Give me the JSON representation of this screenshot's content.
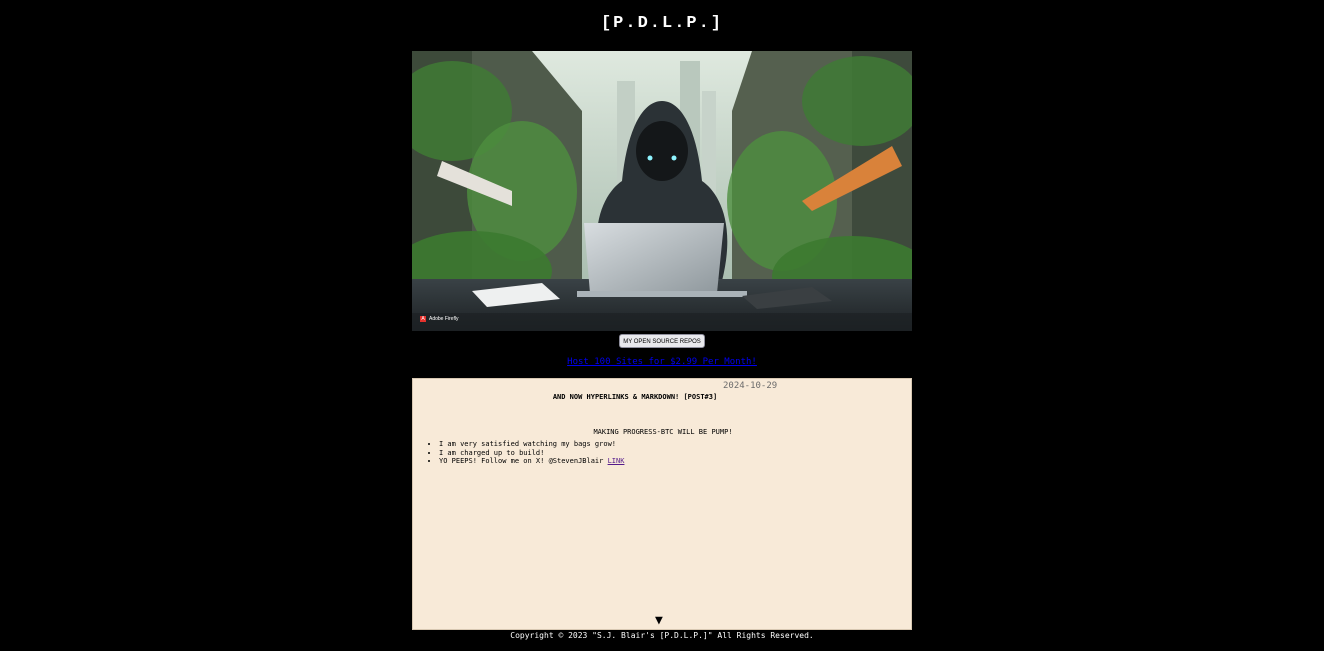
{
  "header": {
    "title": "[P.D.L.P.]"
  },
  "hero": {
    "watermark": "Adobe Firefly"
  },
  "repos_button": {
    "label": "MY OPEN SOURCE REPOS"
  },
  "promo": {
    "link_text": "Host 100 Sites for $2.99 Per Month!"
  },
  "post": {
    "date": "2024-10-29",
    "title": "AND NOW HYPERLINKS & MARKDOWN! [POST#3]",
    "subtitle": "MAKING PROGRESS-BTC WILL BE PUMP!",
    "items": [
      "I am very satisfied watching my bags grow!",
      "I am charged up to build!",
      "YO PEEPS! Follow me on X! @StevenJBlair "
    ],
    "link_text": "LINK",
    "scroll_arrow": "▼"
  },
  "footer": {
    "copyright": "Copyright © 2023 \"S.J. Blair's [P.D.L.P.]\" All Rights Reserved."
  },
  "colors": {
    "background": "#000000",
    "post_background": "#f8ead8",
    "link": "#0000ee",
    "visited_link": "#551a8b"
  }
}
